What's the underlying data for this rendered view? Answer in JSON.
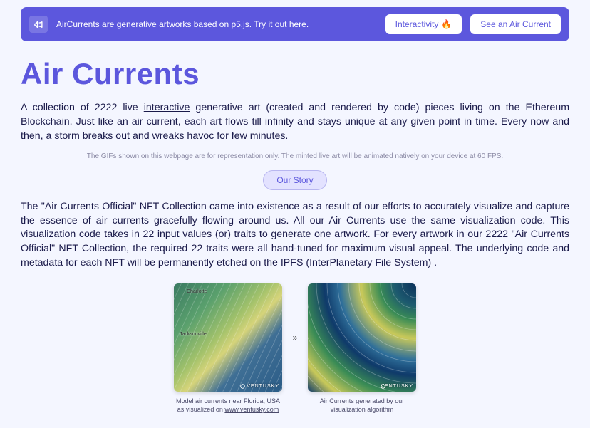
{
  "banner": {
    "text_prefix": "AirCurrents are generative artworks based on p5.js. ",
    "link_text": "Try it out here.",
    "interactivity_label": "Interactivity",
    "interactivity_emoji": "🔥",
    "see_button": "See an Air Current"
  },
  "title": "Air Currents",
  "intro": {
    "seg1": "A collection of 2222 live ",
    "interactive": "interactive",
    "seg2": " generative art (created and rendered by code) pieces living on the Ethereum Blockchain. Just like an air current, each art flows till infinity and stays unique at any given point in time. Every now and then, a ",
    "storm": "storm",
    "seg3": " breaks out and wreaks havoc for few minutes."
  },
  "disclaimer": "The GIFs shown on this webpage are for representation only. The minted live art will be animated natively on your device at 60 FPS.",
  "story_button": "Our Story",
  "story_text": "The \"Air Currents Official\" NFT Collection came into existence as a result of our efforts to accurately visualize and capture the essence of air currents gracefully flowing around us. All our Air Currents use the same visualization code. This visualization code takes in 22 input values (or) traits to generate one artwork. For every artwork in our 2222 \"Air Currents Official\" NFT Collection, the required 22 traits were all hand-tuned for maximum visual appeal. The underlying code and metadata for each NFT will be permanently etched on the IPFS (InterPlanetary File System) .",
  "figures": {
    "left_label_a": "Charlotte",
    "left_label_b": "Jacksonville",
    "brand": "VENTUSKY",
    "arrow_glyph": "»",
    "left_caption_prefix": "Model air currents near Florida, USA as visualized on ",
    "left_caption_link": "www.ventusky.com",
    "right_caption": "Air Currents generated by our visualization algorithm"
  }
}
